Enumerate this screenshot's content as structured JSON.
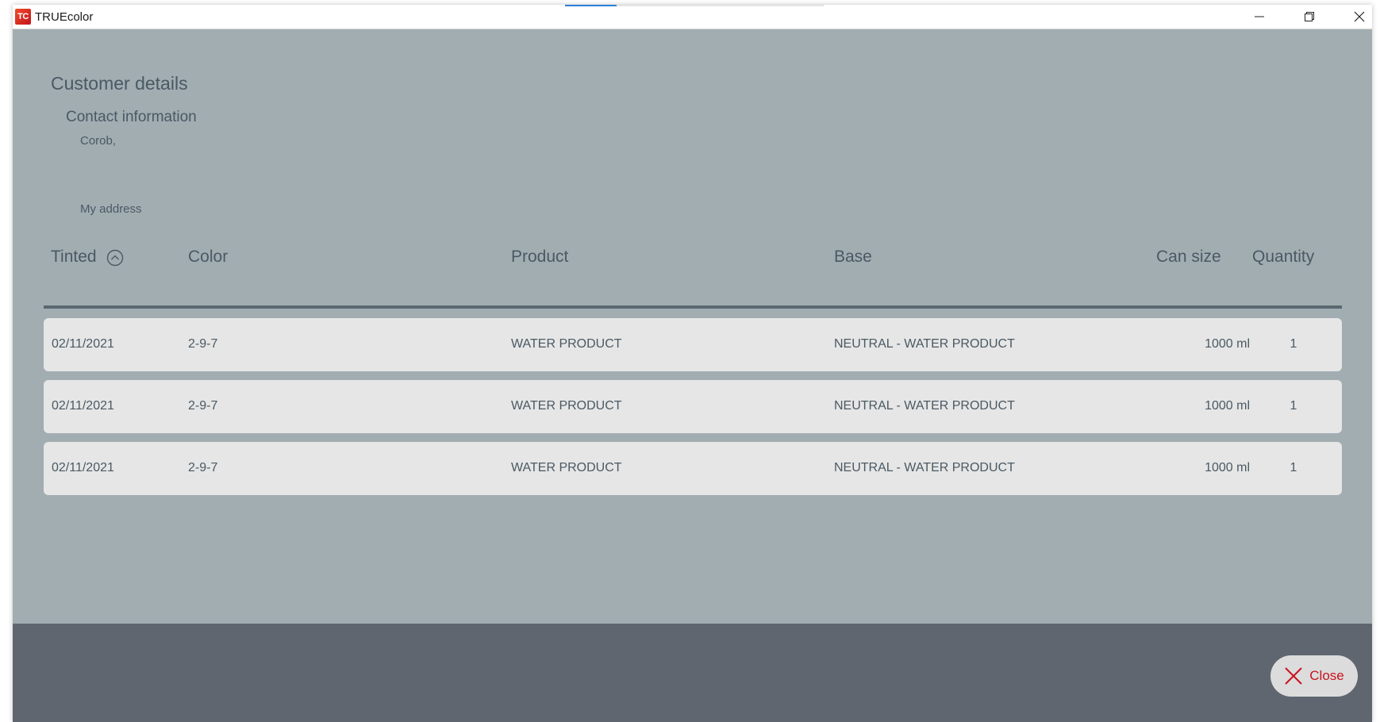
{
  "window": {
    "app_logo": "TC",
    "title": "TRUEcolor",
    "progress_fraction": 0.2
  },
  "customer": {
    "section_title": "Customer details",
    "contact_title": "Contact information",
    "name": "Corob,",
    "address": "My address"
  },
  "table": {
    "headers": {
      "tinted": "Tinted",
      "color": "Color",
      "product": "Product",
      "base": "Base",
      "can_size": "Can size",
      "quantity": "Quantity"
    },
    "sort_icon": "chevron-up-circle-icon",
    "rows": [
      {
        "tinted": "02/11/2021",
        "color": "2-9-7",
        "product": "WATER PRODUCT",
        "base": "NEUTRAL - WATER PRODUCT",
        "can_size": "1000 ml",
        "quantity": "1"
      },
      {
        "tinted": "02/11/2021",
        "color": "2-9-7",
        "product": "WATER PRODUCT",
        "base": "NEUTRAL - WATER PRODUCT",
        "can_size": "1000 ml",
        "quantity": "1"
      },
      {
        "tinted": "02/11/2021",
        "color": "2-9-7",
        "product": "WATER PRODUCT",
        "base": "NEUTRAL - WATER PRODUCT",
        "can_size": "1000 ml",
        "quantity": "1"
      }
    ]
  },
  "footer": {
    "close_label": "Close",
    "close_icon": "x-icon"
  },
  "colors": {
    "background": "#a2adb2",
    "text": "#4a5963",
    "row_background": "#e6e6e6",
    "footer": "#606670",
    "close_accent": "#c8141e"
  }
}
